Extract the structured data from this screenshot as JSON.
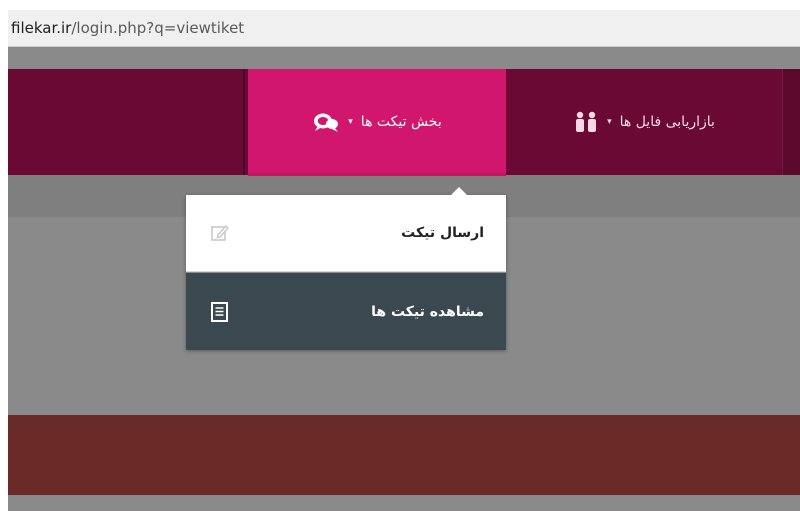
{
  "browser": {
    "address_domain": "filekar.ir",
    "address_path": "/login.php?q=viewtiket"
  },
  "nav": {
    "tickets_label": "بخش تیکت ها",
    "tickets_icon": "chat-bubbles-icon",
    "files_label": "بازاریابی فایل ها",
    "files_icon": "users-icon",
    "caret": "▾"
  },
  "dropdown": {
    "items": [
      {
        "label": "ارسال تیکت",
        "icon": "edit-icon",
        "active": false
      },
      {
        "label": "مشاهده تیکت ها",
        "icon": "list-document-icon",
        "active": true
      }
    ]
  },
  "colors": {
    "nav_bg": "#6a0a34",
    "nav_active": "#d0166d",
    "dropdown_active": "#3a4850",
    "footer": "#6a2a27",
    "overlay": "#8a8a8a"
  }
}
